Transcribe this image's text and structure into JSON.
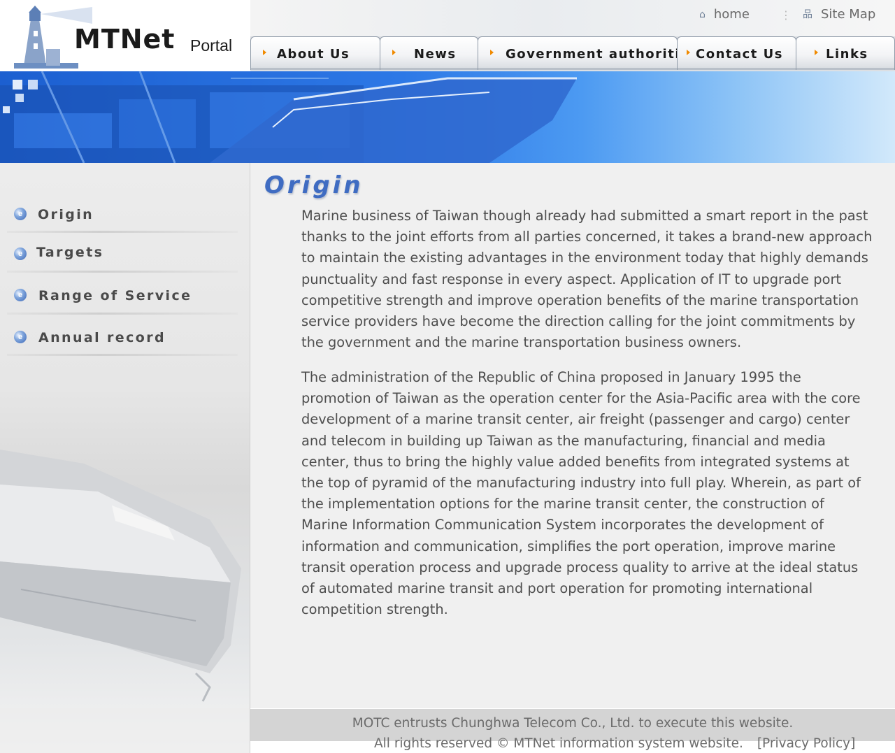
{
  "logo": {
    "title": "MTNet",
    "subtitle": "Portal"
  },
  "utility_links": [
    {
      "label": "home",
      "icon": "home-icon"
    },
    {
      "label": "Site Map",
      "icon": "sitemap-icon"
    }
  ],
  "nav": {
    "tabs": [
      {
        "label": "About Us"
      },
      {
        "label": "News"
      },
      {
        "label": "Government authorities"
      },
      {
        "label": "Contact Us"
      },
      {
        "label": "Links"
      }
    ]
  },
  "sidebar": {
    "items": [
      {
        "label": "Origin"
      },
      {
        "label": "Targets"
      },
      {
        "label": "Range of Service"
      },
      {
        "label": "Annual record"
      }
    ]
  },
  "main": {
    "title": "Origin",
    "paragraphs": [
      "Marine business of Taiwan though already had submitted a smart report in the past thanks to the joint efforts from all parties concerned, it takes a brand-new approach to maintain the existing advantages in the environment today that highly demands punctuality and fast response in every aspect. Application of IT to upgrade port competitive strength and improve operation benefits of the marine transportation service providers have become the direction calling for the joint commitments by the government and the marine transportation business owners.",
      "The administration of the Republic of China proposed in January 1995 the promotion of Taiwan as the operation center for the Asia-Pacific area with the core development of a marine transit center, air freight (passenger and cargo) center and telecom in building up Taiwan as the manufacturing, financial and media center, thus to bring the highly value added benefits from integrated systems at the top of pyramid of the manufacturing industry into full play. Wherein, as part of the implementation options for the marine transit center, the construction of Marine Information Communication System incorporates the development of information and communication, simplifies the port operation, improve marine transit operation process and upgrade process quality to arrive at the ideal status of automated marine transit and port operation for promoting international competition strength."
    ]
  },
  "footer": {
    "line1": "MOTC entrusts Chunghwa Telecom Co., Ltd. to execute this website.",
    "line2": "All rights reserved © MTNet information system website.",
    "privacy": "[Privacy Policy]"
  },
  "colors": {
    "title_blue": "#3f6cc2",
    "banner_blue": "#1c5fd0",
    "nav_arrow": "#f08a00"
  }
}
